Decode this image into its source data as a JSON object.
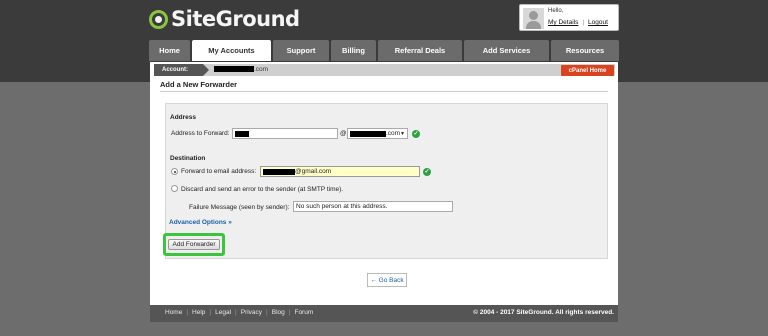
{
  "header": {
    "logo_text": "SiteGround",
    "user": {
      "greeting": "Hello,",
      "my_details": "My Details",
      "logout": "Logout"
    }
  },
  "nav": {
    "tabs": [
      {
        "label": "Home",
        "active": false
      },
      {
        "label": "My Accounts",
        "active": true
      },
      {
        "label": "Support",
        "active": false
      },
      {
        "label": "Billing",
        "active": false
      },
      {
        "label": "Referral Deals",
        "active": false
      },
      {
        "label": "Add Services",
        "active": false
      },
      {
        "label": "Resources",
        "active": false
      }
    ]
  },
  "breadcrumb": {
    "label": "Account:",
    "value_suffix": ".com",
    "cpanel_button": "cPanel Home"
  },
  "page": {
    "title": "Add a New Forwarder"
  },
  "form": {
    "address_heading": "Address",
    "address_label": "Address to Forward:",
    "at_sign": "@",
    "domain_suffix": ".com",
    "destination_heading": "Destination",
    "forward_label": "Forward to email address:",
    "forward_value_suffix": "@gmail.com",
    "discard_label": "Discard and send an error to the sender (at SMTP time).",
    "failure_label": "Failure Message (seen by sender):",
    "failure_value": "No such person at this address.",
    "advanced_options": "Advanced Options »",
    "submit_label": "Add Forwarder",
    "go_back": "← Go Back"
  },
  "footer": {
    "links": [
      "Home",
      "Help",
      "Legal",
      "Privacy",
      "Blog",
      "Forum"
    ],
    "copyright": "© 2004 - 2017 SiteGround. All rights reserved."
  },
  "colors": {
    "accent_green": "#3cc53c",
    "cpanel_orange": "#d9431f",
    "link_blue": "#1b5fa8"
  }
}
